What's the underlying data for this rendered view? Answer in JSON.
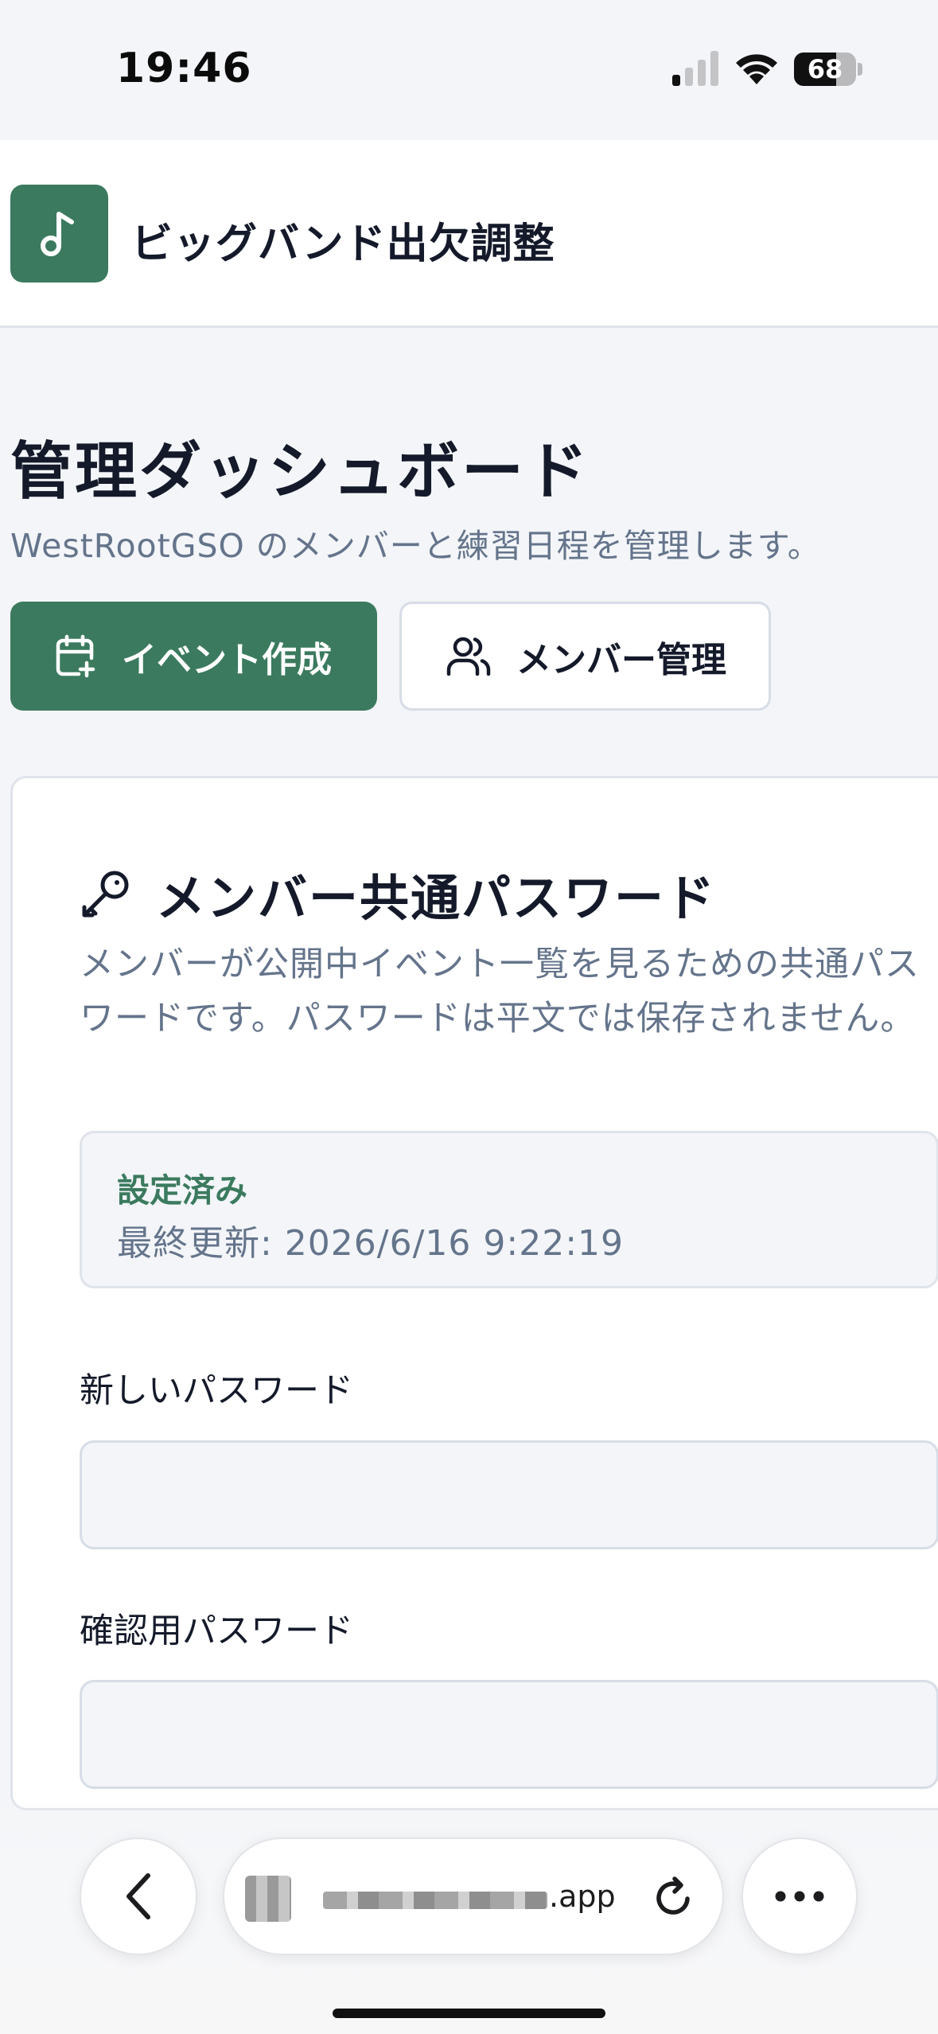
{
  "status_bar": {
    "time": "19:46",
    "battery_level": "68",
    "battery_fraction": 0.68
  },
  "header": {
    "app_title": "ビッグバンド出欠調整",
    "logo_icon": "music-note-icon"
  },
  "page": {
    "title": "管理ダッシュボード",
    "subtitle": "WestRootGSO のメンバーと練習日程を管理します。"
  },
  "actions": {
    "create_event": "イベント作成",
    "manage_members": "メンバー管理"
  },
  "password_card": {
    "title": "メンバー共通パスワード",
    "description": "メンバーが公開中イベント一覧を見るための共通パスワードです。パスワードは平文では保存されません。",
    "status": "設定済み",
    "last_updated": "最終更新: 2026/6/16 9:22:19",
    "new_password_label": "新しいパスワード",
    "new_password_value": "",
    "confirm_password_label": "確認用パスワード",
    "confirm_password_value": ""
  },
  "browser": {
    "url_suffix": ".app"
  },
  "colors": {
    "accent": "#3b7a5e",
    "background": "#f3f5f8",
    "muted_text": "#64748b",
    "border": "#dfe3ea"
  }
}
